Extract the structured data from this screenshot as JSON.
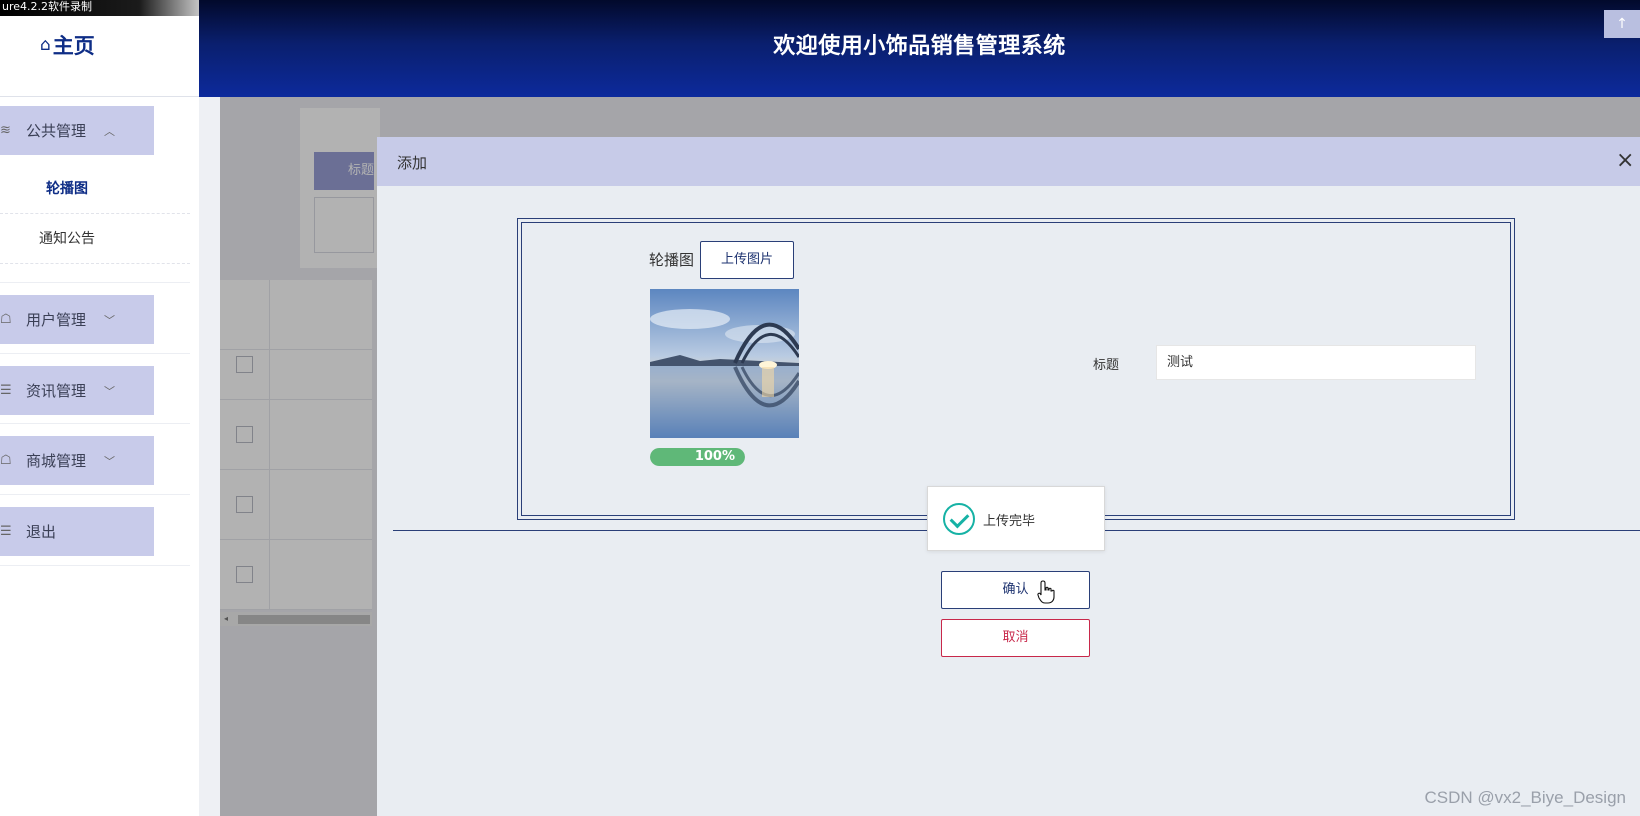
{
  "recorder": {
    "label": "ure4.2.2软件录制"
  },
  "header": {
    "home_label": "主页",
    "home_icon": "home-icon",
    "title": "欢迎使用小饰品销售管理系统",
    "corner_glyph": "↑"
  },
  "sidebar": {
    "groups": [
      {
        "label": "公共管理",
        "icon": "layers-icon",
        "expanded": true,
        "items": [
          {
            "label": "轮播图",
            "active": true
          },
          {
            "label": "通知公告",
            "active": false
          }
        ]
      },
      {
        "label": "用户管理",
        "icon": "user-icon",
        "expanded": false
      },
      {
        "label": "资讯管理",
        "icon": "list-icon",
        "expanded": false
      },
      {
        "label": "商城管理",
        "icon": "shop-icon",
        "expanded": false
      },
      {
        "label": "退出",
        "icon": "logout-icon",
        "expanded": false
      }
    ]
  },
  "background": {
    "search_tag": "标题"
  },
  "dialog": {
    "title": "添加",
    "close_glyph": "×",
    "carousel_label": "轮播图",
    "upload_button": "上传图片",
    "progress_percent": 100,
    "progress_text": "100%",
    "title_label": "标题",
    "title_value": "测试",
    "toast_text": "上传完毕",
    "confirm_button": "确认",
    "cancel_button": "取消"
  },
  "colors": {
    "header_blue": "#0c2a9c",
    "menu_bg": "#c8cbea",
    "dialog_head": "#c7cbe8",
    "accent": "#2a3f78",
    "danger": "#c8284a",
    "progress_green": "#5fb878",
    "success_teal": "#16b2a5"
  },
  "watermark": "CSDN @vx2_Biye_Design"
}
